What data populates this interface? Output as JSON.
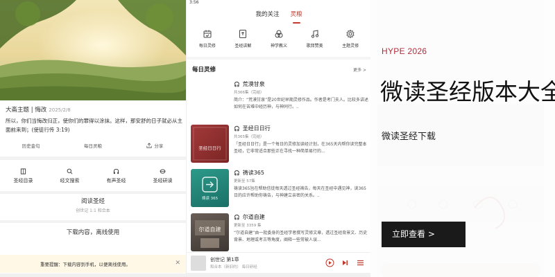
{
  "left_panel": {
    "verse": {
      "title": "大斋主题 | 悔改",
      "date": "2025/2/8",
      "text": "所以，你们当悔改归正，使你们的罪得以涂抹。这样，那安舒的日子就必从主面前来到；(使徒行传 3:19)"
    },
    "verse_actions": [
      "历史金句",
      "每日灵粮",
      "分享"
    ],
    "functions": [
      {
        "label": "圣经目录",
        "icon": "book-icon"
      },
      {
        "label": "经文搜索",
        "icon": "search-icon"
      },
      {
        "label": "有声圣经",
        "icon": "headphones-icon"
      },
      {
        "label": "圣经研读",
        "icon": "study-icon"
      }
    ],
    "read_section": {
      "title": "阅读圣经",
      "subtitle": "创世记 1:1 和合本"
    },
    "download_label": "下载内容，离线使用",
    "notice_text": "重要提醒：下载内容到手机，以便离线使用。",
    "notice_close": "✕"
  },
  "middle_panel": {
    "status_time": "3:56",
    "tabs": [
      {
        "label": "我的关注",
        "active": false
      },
      {
        "label": "灵粮",
        "active": true
      }
    ],
    "categories": [
      {
        "label": "每日灵修",
        "icon": "calendar-icon"
      },
      {
        "label": "圣经讲解",
        "icon": "bible-icon"
      },
      {
        "label": "神学教义",
        "icon": "theology-icon"
      },
      {
        "label": "歌拜赞美",
        "icon": "music-icon"
      },
      {
        "label": "主题灵修",
        "icon": "gear-icon"
      }
    ],
    "section_title": "每日灵修",
    "section_more": "更多 >",
    "items": [
      {
        "title": "荒漠甘泉",
        "meta": "共366集（完结）",
        "desc": "简介：“荒漠甘泉”是20世纪早期灵修作品。作者是考门夫人。比较多讲述如何在苦难中经历神，与神同行。.."
      },
      {
        "title": "圣经日日行",
        "meta": "共365集（完结）",
        "desc": "「圣经日日行」是一个每日的灵修加读经计划，在365天内帮你读完整本圣经，它非常适合那些正在寻找一种简单易行的..."
      },
      {
        "title": "祷读365",
        "meta": "更新至 57集",
        "desc": "祷读365旨在帮助信徒每天透过圣经祷告，每天在圣经中遇见神，读365日的应许帮助你祷告，与神建立亲密的关系。.."
      },
      {
        "title": "尔道自建",
        "meta": "更新至 3359 集",
        "desc": "“尔道自建”由一批委身的圣经学者撰写灵修文章，透过圣经背景文、历史背景、地理或考古等角度，阐释一些常被人误..."
      }
    ],
    "item_thumb_texts": [
      "",
      "圣经日日行",
      "祷读 365",
      "尔道自建"
    ],
    "player": {
      "title": "创世记 第1章",
      "subtitle": "和合本（新旧约）  每日研经"
    }
  },
  "right_panel": {
    "tag": "HYPE 2026",
    "title": "微读圣经版本大全",
    "subtitle": "微读圣经下载",
    "cta": "立即查看 >",
    "accent": "#b22b3a"
  }
}
